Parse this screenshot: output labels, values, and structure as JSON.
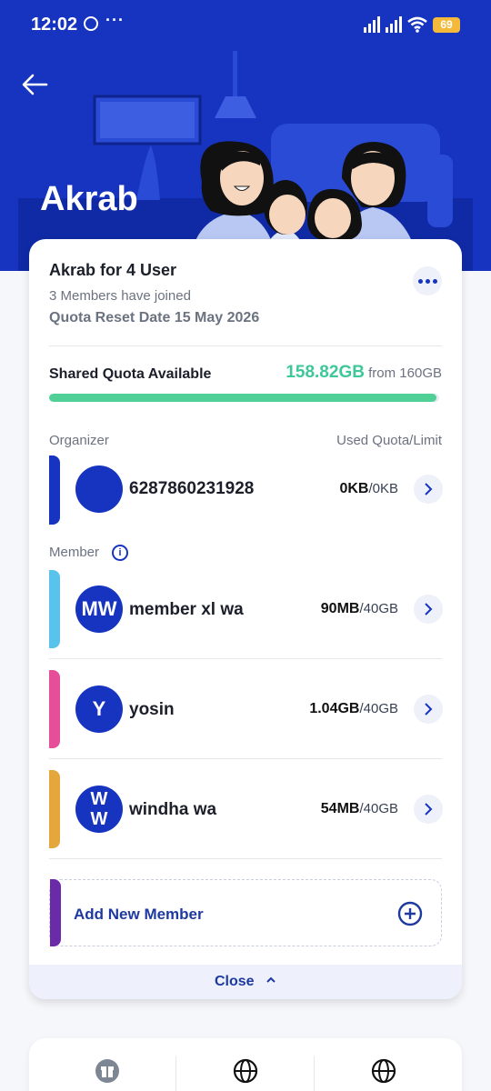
{
  "status_bar": {
    "time": "12:02",
    "more": "···",
    "battery": "69"
  },
  "header": {
    "title": "Akrab"
  },
  "package": {
    "name": "Akrab for 4 User",
    "members_joined": "3 Members have joined",
    "quota_reset": "Quota Reset Date 15 May 2026"
  },
  "shared_quota": {
    "label": "Shared Quota Available",
    "available": "158.82GB",
    "total": " from 160GB",
    "fraction": 0.9926
  },
  "sections": {
    "organizer_label": "Organizer",
    "used_quota_label": "Used Quota/Limit",
    "member_label": "Member"
  },
  "organizer": {
    "name": "6287860231928",
    "initials": "",
    "used": "0KB",
    "limit": "/0KB",
    "accent": "#1634c0"
  },
  "members": [
    {
      "name": "member xl wa",
      "initials": "MW",
      "used": "90MB",
      "limit": "/40GB",
      "accent": "#5ac3ec"
    },
    {
      "name": "yosin",
      "initials": "Y",
      "used": "1.04GB",
      "limit": "/40GB",
      "accent": "#e54f9a"
    },
    {
      "name": "windha wa",
      "initials": "W\nW",
      "used": "54MB",
      "limit": "/40GB",
      "accent": "#e3a73b"
    }
  ],
  "add_member": {
    "label": "Add New Member"
  },
  "close": {
    "label": "Close"
  },
  "colors": {
    "brand": "#1634c0",
    "progress": "#50cf96",
    "quota_green": "#3fc799"
  },
  "bottom_icons": [
    "gift-icon",
    "globe-icon",
    "globe-icon"
  ]
}
